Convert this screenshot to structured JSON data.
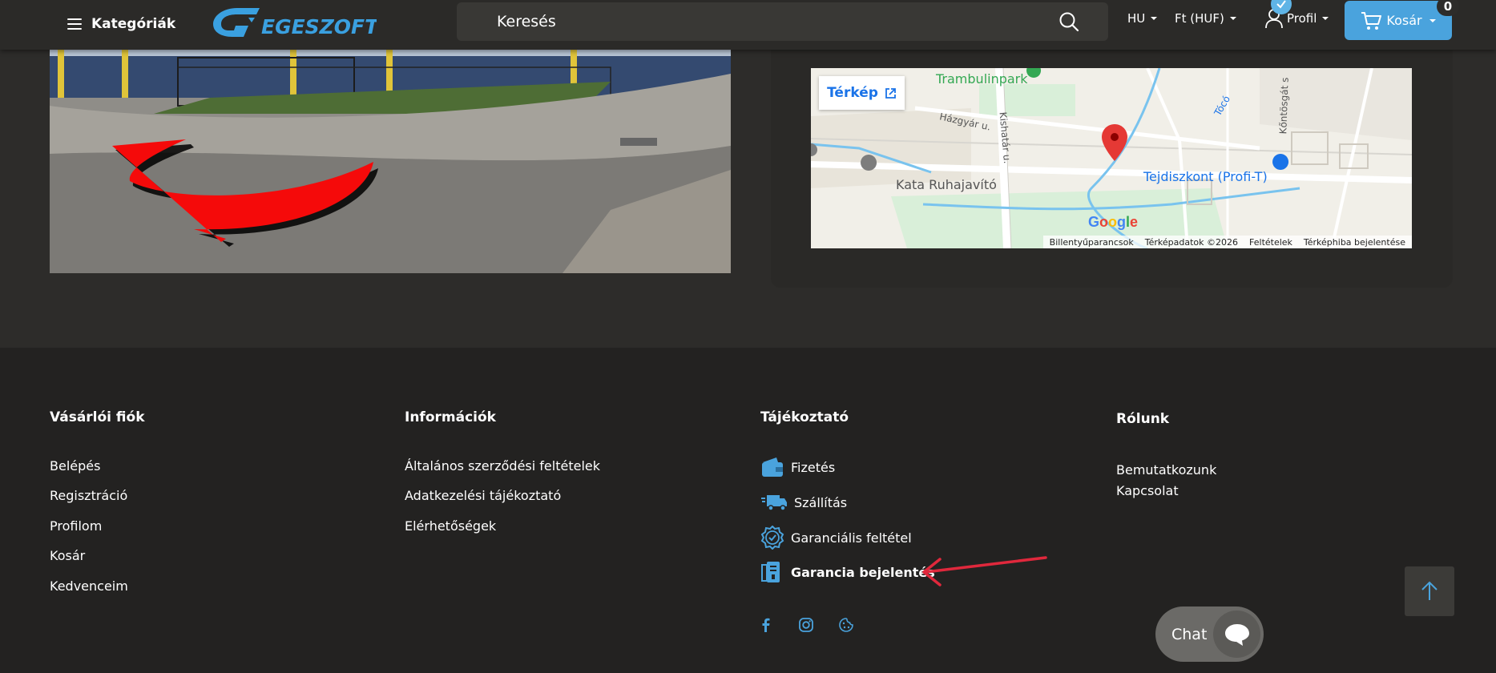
{
  "header": {
    "categories_label": "Kategóriák",
    "logo_text": "EGESZOFT",
    "search_placeholder": "Keresés",
    "language": "HU",
    "currency": "Ft (HUF)",
    "profile_label": "Profil",
    "cart_label": "Kosár",
    "cart_count": "0"
  },
  "map": {
    "link_label": "Térkép",
    "places": [
      "Trambulinpark",
      "Kata Ruhajavító",
      "Tejdiszkont (Profi-T)"
    ],
    "streets": [
      "Házgyár u.",
      "Kishatár u.",
      "Tócó",
      "Kőntösgát s"
    ],
    "footer": [
      "Billentyűparancsok",
      "Térképadatok ©2026",
      "Feltételek",
      "Térképhiba bejelentése"
    ]
  },
  "footer": {
    "account": {
      "title": "Vásárlói fiók",
      "links": [
        "Belépés",
        "Regisztráció",
        "Profilom",
        "Kosár",
        "Kedvenceim"
      ]
    },
    "info": {
      "title": "Információk",
      "links": [
        "Általános szerződési feltételek",
        "Adatkezelési tájékoztató",
        "Elérhetőségek"
      ]
    },
    "guide": {
      "title": "Tájékoztató",
      "links": [
        "Fizetés",
        "Szállítás",
        "Garanciális feltétel",
        "Garancia bejelentés"
      ]
    },
    "about": {
      "title": "Rólunk",
      "links": [
        "Bemutatkozunk",
        "Kapcsolat"
      ]
    }
  },
  "chat": {
    "label": "Chat"
  },
  "colors": {
    "accent": "#4aa3dd",
    "annotation": "#e0283c"
  },
  "icons": [
    "menu-icon",
    "search-icon",
    "user-icon",
    "cart-icon",
    "external-link-icon",
    "wallet-icon",
    "truck-icon",
    "badge-check-icon",
    "warranty-form-icon",
    "facebook-icon",
    "instagram-icon",
    "cookie-icon",
    "arrow-up-icon",
    "chat-bubble-icon",
    "map-pin-icon"
  ]
}
